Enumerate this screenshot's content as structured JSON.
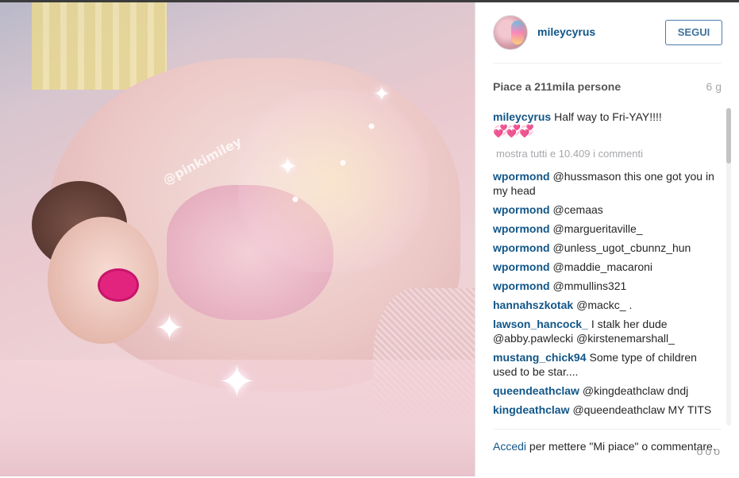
{
  "photo": {
    "watermark": "@pinkimiley"
  },
  "header": {
    "username": "mileycyrus",
    "follow_label": "SEGUI"
  },
  "meta": {
    "likes": "Piace a 211mila persone",
    "age": "6 g"
  },
  "caption": {
    "user": "mileycyrus",
    "text": "Half way to Fri-YAY!!!!",
    "emoji": "💞💞💞"
  },
  "show_all": "mostra tutti e 10.409 i commenti",
  "comments": [
    {
      "user": "wpormond",
      "text": "@hussmason this one got you in my head"
    },
    {
      "user": "wpormond",
      "text": "@cemaas"
    },
    {
      "user": "wpormond",
      "text": "@margueritaville_"
    },
    {
      "user": "wpormond",
      "text": "@unless_ugot_cbunnz_hun"
    },
    {
      "user": "wpormond",
      "text": "@maddie_macaroni"
    },
    {
      "user": "wpormond",
      "text": "@mmullins321"
    },
    {
      "user": "hannahszkotak",
      "text": "@mackc_ ."
    },
    {
      "user": "lawson_hancock_",
      "text": "I stalk her dude @abby.pawlecki @kirstenemarshall_"
    },
    {
      "user": "mustang_chick94",
      "text": "Some type of children used to be star...."
    },
    {
      "user": "queendeathclaw",
      "text": "@kingdeathclaw dndj"
    },
    {
      "user": "kingdeathclaw",
      "text": "@queendeathclaw MY TITS"
    }
  ],
  "footer": {
    "login_link": "Accedi",
    "rest": " per mettere \"Mi piace\" o commentare.",
    "more": "ooo"
  },
  "colors": {
    "link": "#125688",
    "follow_border": "#4b7ba9",
    "muted": "#a5a7aa"
  }
}
